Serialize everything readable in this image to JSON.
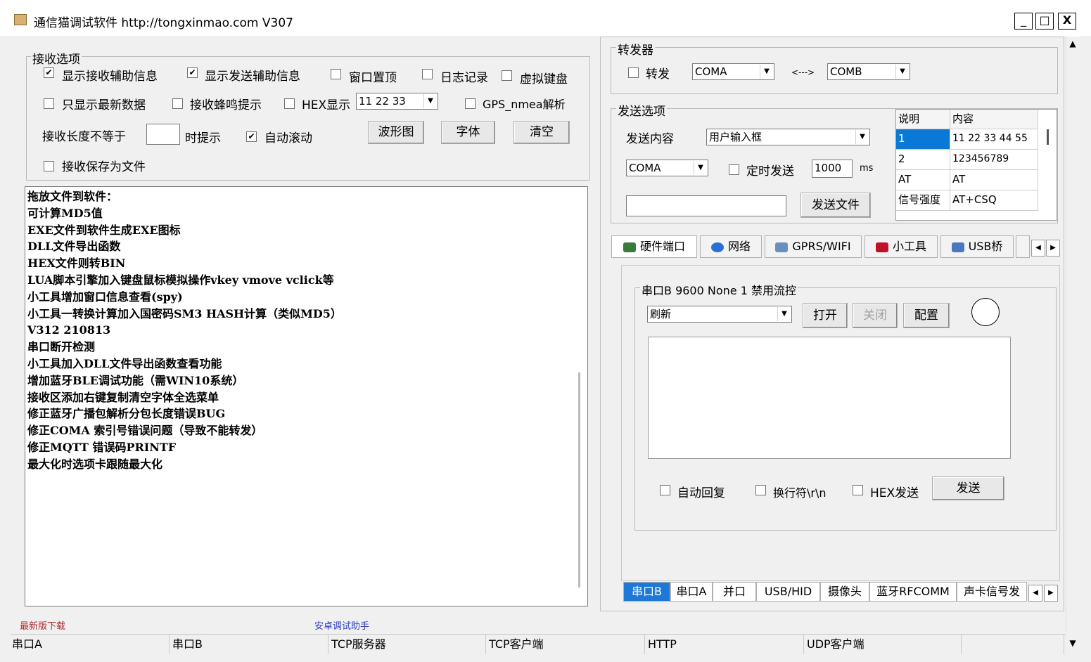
{
  "window": {
    "title": "通信猫调试软件  http://tongxinmao.com  V307",
    "minimize": "_",
    "maximize": "□",
    "close": "X"
  },
  "receive_options": {
    "group_label": "接收选项",
    "show_recv_info": {
      "label": "显示接收辅助信息",
      "checked": true
    },
    "show_send_info": {
      "label": "显示发送辅助信息",
      "checked": true
    },
    "window_top": {
      "label": "窗口置顶",
      "checked": false
    },
    "log_record": {
      "label": "日志记录",
      "checked": false
    },
    "virtual_keyboard": {
      "label": "虚拟键盘",
      "checked": false
    },
    "only_latest": {
      "label": "只显示最新数据",
      "checked": false
    },
    "beep": {
      "label": "接收蜂鸣提示",
      "checked": false
    },
    "hex_display": {
      "label": "HEX显示",
      "checked": false
    },
    "hex_combo_value": "11 22 33",
    "gps": {
      "label": "GPS_nmea解析",
      "checked": false
    },
    "length_prefix": "接收长度不等于",
    "length_value": "",
    "length_suffix": "时提示",
    "auto_scroll": {
      "label": "自动滚动",
      "checked": true
    },
    "waveform_button": "波形图",
    "font_button": "字体",
    "clear_button": "清空",
    "save_to_file": {
      "label": "接收保存为文件",
      "checked": false
    }
  },
  "receive_text": [
    "拖放文件到软件：",
    "可计算MD5值",
    "EXE文件到软件生成EXE图标",
    "DLL文件导出函数",
    "HEX文件则转BIN",
    "",
    "LUA脚本引擎加入键盘鼠标模拟操作vkey vmove vclick等",
    "小工具增加窗口信息查看(spy)",
    "小工具一转换计算加入国密码SM3 HASH计算（类似MD5）",
    "",
    "",
    "V312 210813",
    "串口断开检测",
    "小工具加入DLL文件导出函数查看功能",
    "增加蓝牙BLE调试功能（需WIN10系统）",
    "接收区添加右键复制清空字体全选菜单",
    "修正蓝牙广播包解析分包长度错误BUG",
    "修正COMA 索引号错误问题（导致不能转发）",
    "修正MQTT 错误码PRINTF",
    "最大化时选项卡跟随最大化"
  ],
  "links": {
    "latest_download": "最新版下载",
    "android_helper": "安卓调试助手"
  },
  "forwarder": {
    "group_label": "转发器",
    "forward": {
      "label": "转发",
      "checked": false
    },
    "from_port": "COMA",
    "arrow": "<--->",
    "to_port": "COMB"
  },
  "send_options": {
    "group_label": "发送选项",
    "content_label": "发送内容",
    "content_source": "用户输入框",
    "port": "COMA",
    "timed_send": {
      "label": "定时发送",
      "checked": false
    },
    "interval": "1000",
    "interval_unit": "ms",
    "file_path": "",
    "send_file_button": "发送文件",
    "table_headers": [
      "说明",
      "内容"
    ],
    "table_rows": [
      [
        "1",
        "11 22 33 44 55"
      ],
      [
        "2",
        "123456789"
      ],
      [
        "AT",
        "AT"
      ],
      [
        "信号强度",
        "AT+CSQ"
      ]
    ]
  },
  "main_tabs": [
    {
      "label": "硬件端口",
      "icon": "circuit-board-icon",
      "color": "#3a7a3a"
    },
    {
      "label": "网络",
      "icon": "network-icon",
      "color": "#2a6fd6"
    },
    {
      "label": "GPRS/WIFI",
      "icon": "wifi-icon",
      "color": "#6a8fbf"
    },
    {
      "label": "小工具",
      "icon": "toolbox-icon",
      "color": "#c0102a"
    },
    {
      "label": "USB桥",
      "icon": "usb-icon",
      "color": "#4a78c0"
    }
  ],
  "port_panel": {
    "group_label": "串口B  9600  None  1 禁用流控",
    "refresh_combo": "刷新",
    "open_button": "打开",
    "close_button": "关闭",
    "config_button": "配置",
    "auto_reply": {
      "label": "自动回复",
      "checked": false
    },
    "newline": {
      "label": "换行符\\r\\n",
      "checked": false
    },
    "hex_send": {
      "label": "HEX发送",
      "checked": false
    },
    "send_button": "发送"
  },
  "bottom_tabs": [
    "串口B",
    "串口A",
    "并口",
    "USB/HID",
    "摄像头",
    "蓝牙RFCOMM",
    "声卡信号发"
  ],
  "status_bar": [
    "串口A",
    "串口B",
    "TCP服务器",
    "TCP客户端",
    "HTTP",
    "UDP客户端",
    ""
  ],
  "colors": {
    "active_tab": "#1e78d8",
    "link_red": "#b03030",
    "link_blue": "#3040c0"
  }
}
